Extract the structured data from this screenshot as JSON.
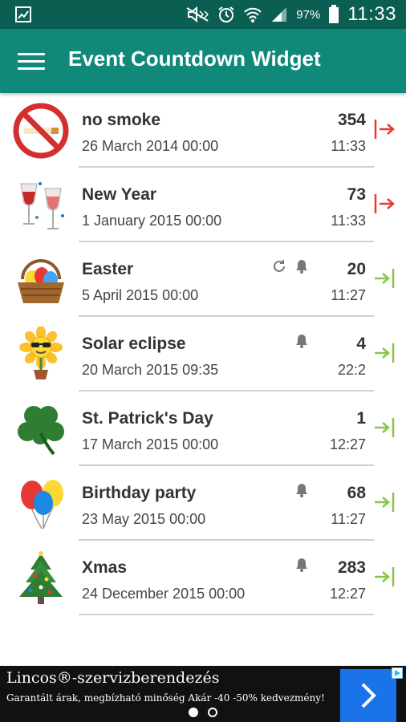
{
  "status_bar": {
    "battery": "97%",
    "time": "11:33"
  },
  "app_bar": {
    "title": "Event Countdown Widget"
  },
  "events": [
    {
      "title": "no smoke",
      "date": "26 March 2014 00:00",
      "count": "354",
      "time": "11:33",
      "icon": "no-smoking-icon",
      "direction": "since",
      "repeat": false,
      "alarm": false
    },
    {
      "title": "New Year",
      "date": "1 January 2015 00:00",
      "count": "73",
      "time": "11:33",
      "icon": "champagne-glasses-icon",
      "direction": "since",
      "repeat": false,
      "alarm": false
    },
    {
      "title": "Easter",
      "date": "5 April 2015 00:00",
      "count": "20",
      "time": "11:27",
      "icon": "easter-basket-icon",
      "direction": "until",
      "repeat": true,
      "alarm": true
    },
    {
      "title": "Solar eclipse",
      "date": "20 March 2015 09:35",
      "count": "4",
      "time": "22:2",
      "icon": "sunflower-icon",
      "direction": "until",
      "repeat": false,
      "alarm": true
    },
    {
      "title": "St. Patrick's Day",
      "date": "17 March 2015 00:00",
      "count": "1",
      "time": "12:27",
      "icon": "shamrock-icon",
      "direction": "until",
      "repeat": false,
      "alarm": false
    },
    {
      "title": "Birthday party",
      "date": "23 May 2015 00:00",
      "count": "68",
      "time": "11:27",
      "icon": "balloons-icon",
      "direction": "until",
      "repeat": false,
      "alarm": true
    },
    {
      "title": "Xmas",
      "date": "24 December 2015 00:00",
      "count": "283",
      "time": "12:27",
      "icon": "christmas-tree-icon",
      "direction": "until",
      "repeat": false,
      "alarm": true
    }
  ],
  "ad": {
    "title": "Lincos®-szervizberendezés",
    "text": "Garantált árak, megbízható minőség Akár -40 -50% kedvezmény!"
  },
  "colors": {
    "status_bar": "#0b5e52",
    "app_bar": "#10897a",
    "since_arrow": "#e53935",
    "until_arrow": "#8bc34a"
  }
}
